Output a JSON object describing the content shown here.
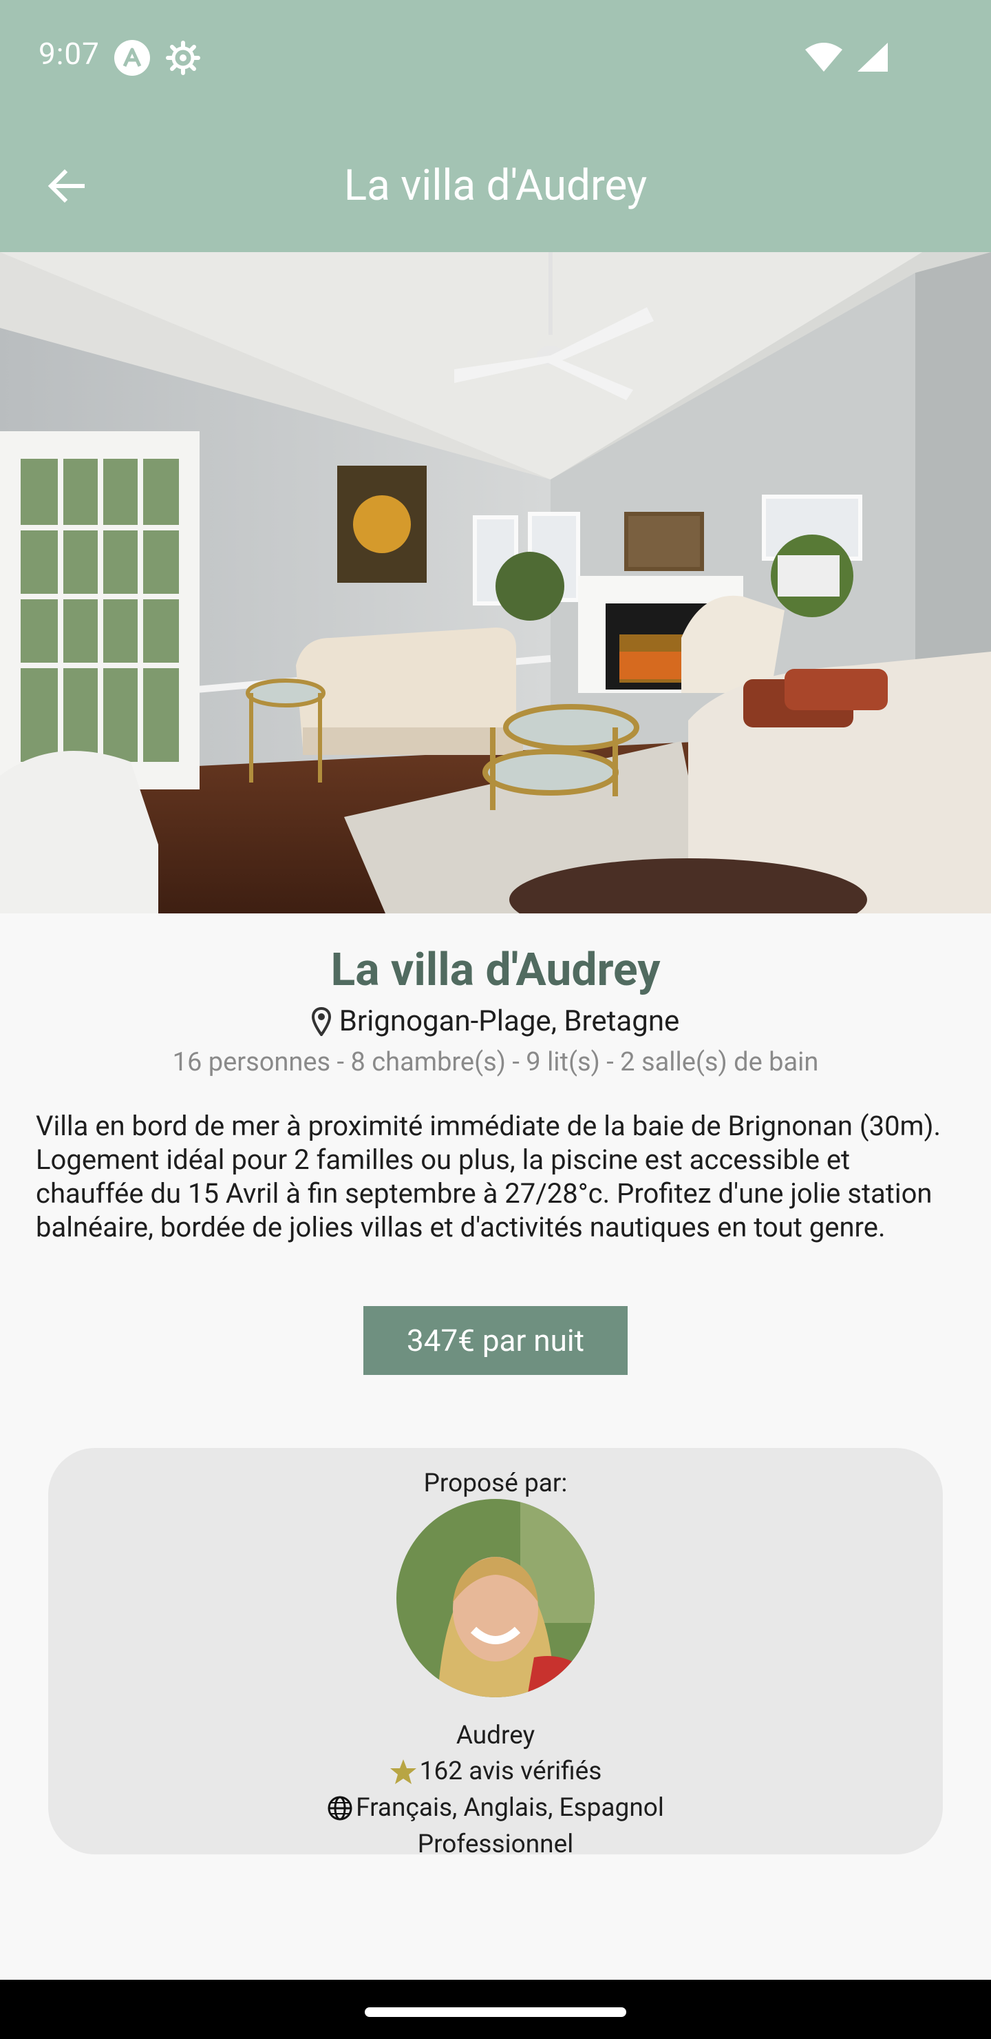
{
  "status_bar": {
    "time": "9:07",
    "icons_left": [
      "app-a-icon",
      "settings-gear-icon"
    ],
    "icons_right": [
      "wifi-icon",
      "cell-signal-icon"
    ]
  },
  "app_bar": {
    "title": "La villa d'Audrey",
    "back_icon": "arrow-back-icon"
  },
  "listing": {
    "title": "La villa d'Audrey",
    "location": "Brignogan-Plage, Bretagne",
    "capacity": "16 personnes - 8 chambre(s) - 9 lit(s) - 2 salle(s) de bain",
    "description": "Villa en bord de mer à proximité immédiate de la baie de Brignonan (30m). Logement idéal pour 2 familles ou plus, la piscine est accessible et chauffée du 15 Avril à fin septembre à 27/28°c. Profitez d'une jolie station balnéaire, bordée de jolies villas et d'activités nautiques en tout genre.",
    "price_label": "347€ par nuit"
  },
  "host": {
    "label": "Proposé par:",
    "name": "Audrey",
    "reviews": "162 avis vérifiés",
    "languages": "Français, Anglais, Espagnol",
    "type": "Professionnel"
  },
  "colors": {
    "app_bar": "#a3c3b3",
    "title_green": "#516b60",
    "price_button": "#6f9080",
    "star": "#b8a544",
    "card_bg": "#e8e8e8"
  }
}
